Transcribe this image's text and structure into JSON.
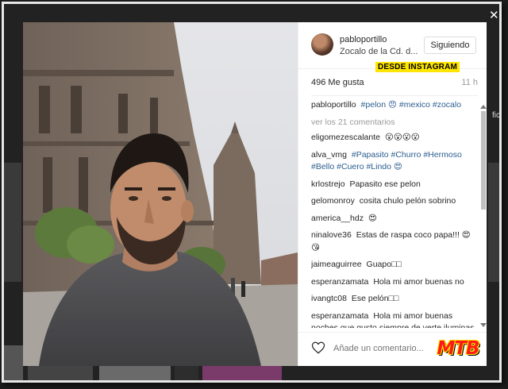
{
  "post": {
    "username": "pabloportillo",
    "location": "Zocalo de la Cd. d...",
    "follow_label": "Siguiendo",
    "watermark_tag": "DESDE INSTAGRAM",
    "likes": "496 Me gusta",
    "time_ago": "11 h",
    "more_comments": "ver los 21 comentarios",
    "add_comment_placeholder": "Añade un comentario...",
    "logo_text": "MTB",
    "side_text": "fici"
  },
  "comments": [
    {
      "user": "pabloportillo",
      "text": "#pelon 😠 #mexico #zocalo"
    },
    {
      "user": "eligomezescalante",
      "text": "😮😮😮😮"
    },
    {
      "user": "alva_vmg",
      "text": "#Papasito #Churro #Hermoso #Bello #Cuero #Lindo 😍"
    },
    {
      "user": "krlostrejo",
      "text": "Papasito ese pelon"
    },
    {
      "user": "gelomonroy",
      "text": "cosita chulo pelón sobrino"
    },
    {
      "user": "america__hdz",
      "text": "😍"
    },
    {
      "user": "ninalove36",
      "text": "Estas de raspa coco papa!!! 😍😘"
    },
    {
      "user": "jaimeaguirree",
      "text": "Guapo□□"
    },
    {
      "user": "esperanzamata",
      "text": "Hola mi amor buenas no"
    },
    {
      "user": "ivangtc08",
      "text": "Ese pelón□□"
    },
    {
      "user": "esperanzamata",
      "text": "Hola mi amor buenas noches que gusto siempre de verte iluminas mi noche mi ser mi corazon que Dios te bendiga mi amor 😘😘💖❤□□"
    }
  ],
  "colors": {
    "hashtag": "#2c5d8f",
    "tag_bg": "#ffe600",
    "logo_red": "#ff1a1a"
  }
}
